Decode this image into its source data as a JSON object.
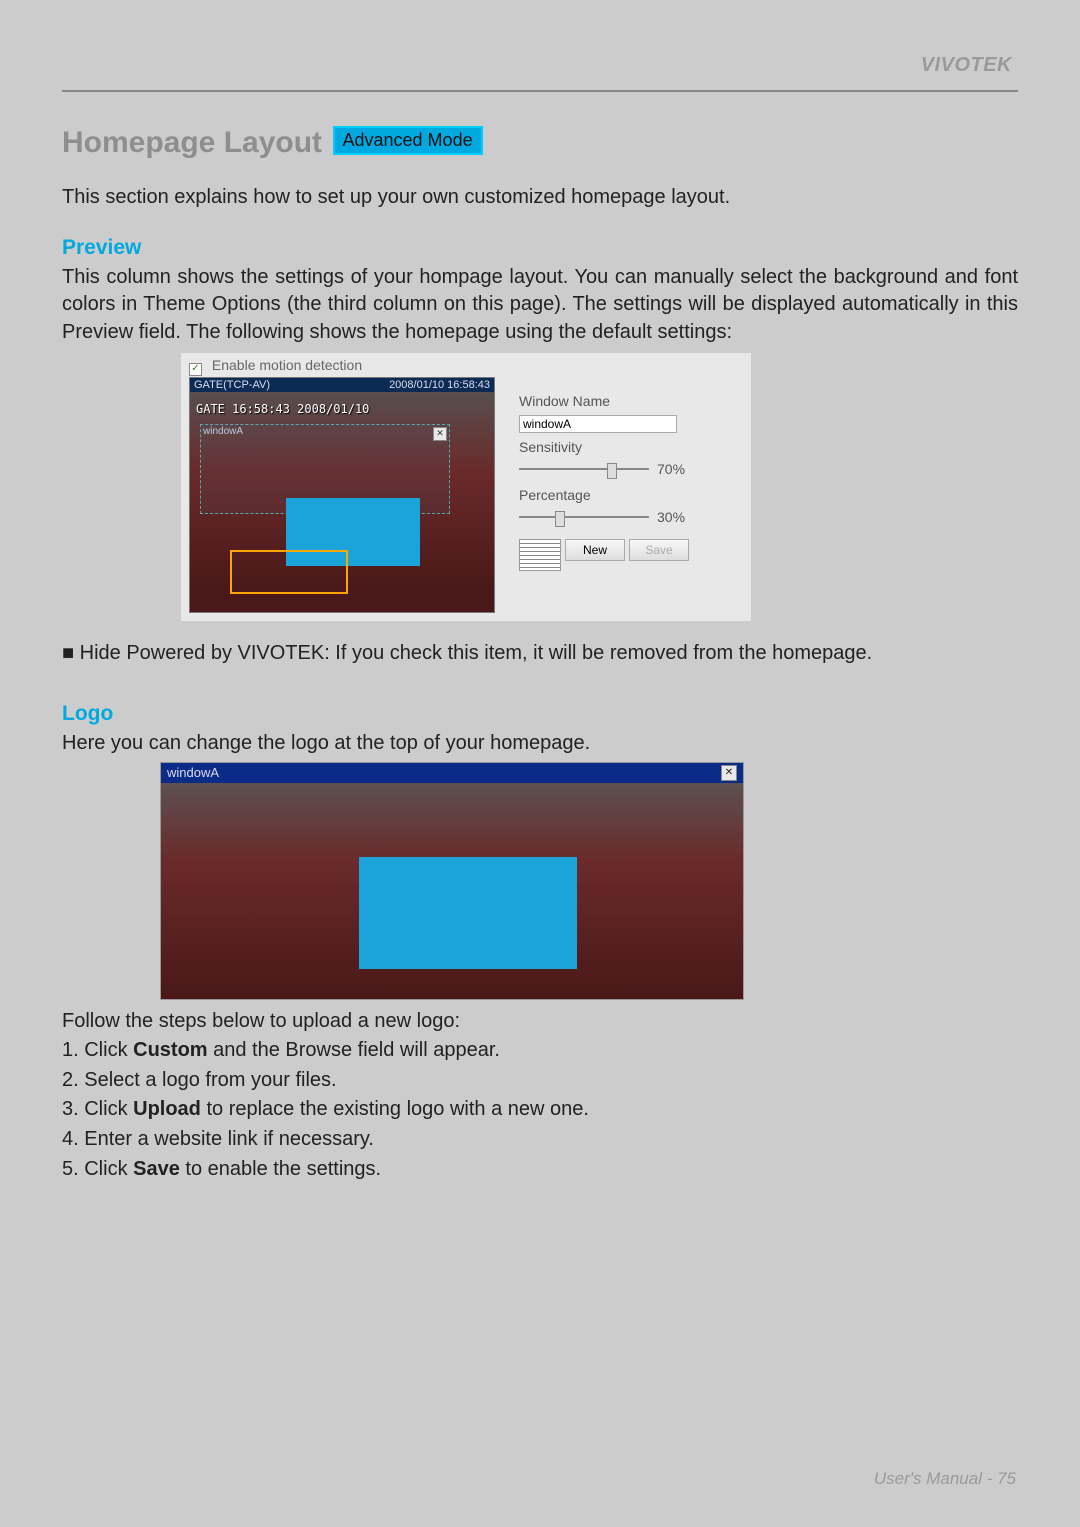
{
  "brand": "VIVOTEK",
  "title": "Homepage Layout",
  "badge_label": "Advanced Mode",
  "intro": "This section explains how to set up your own customized homepage layout.",
  "preview": {
    "heading": "Preview",
    "body": "This column shows the settings of your hompage layout. You can manually select the background and font colors in Theme Options (the third column on this page). The settings will be displayed automatically in this Preview field. The following shows the homepage using the default settings:"
  },
  "shot1": {
    "enable_motion_label": "Enable motion detection",
    "titlebar_left": "GATE(TCP-AV)",
    "titlebar_right": "2008/01/10 16:58:43",
    "overlay_text": "GATE 16:58:43 2008/01/10",
    "sel_label": "windowA",
    "close_glyph": "✕",
    "panel": {
      "window_name_label": "Window Name",
      "window_name_value": "windowA",
      "sensitivity_label": "Sensitivity",
      "sensitivity_value": "70%",
      "percentage_label": "Percentage",
      "percentage_value": "30%",
      "new_btn": "New",
      "save_btn": "Save"
    }
  },
  "bullet_hide": "■ Hide Powered by VIVOTEK: If you check this item, it will be removed from the homepage.",
  "logo": {
    "heading": "Logo",
    "body": "Here you can change the logo at the top of your homepage."
  },
  "shot2": {
    "title": "windowA",
    "close_glyph": "✕"
  },
  "steps_intro": "Follow the steps below to upload a new logo:",
  "steps": {
    "s1a": "1. Click ",
    "s1b": "Custom",
    "s1c": " and the Browse field will appear.",
    "s2": "2. Select a logo from your files.",
    "s3a": "3. Click ",
    "s3b": "Upload",
    "s3c": " to replace the existing logo with a new one.",
    "s4": "4. Enter a website link if necessary.",
    "s5a": "5. Click ",
    "s5b": "Save",
    "s5c": " to enable the settings."
  },
  "footer": "User's Manual - 75"
}
